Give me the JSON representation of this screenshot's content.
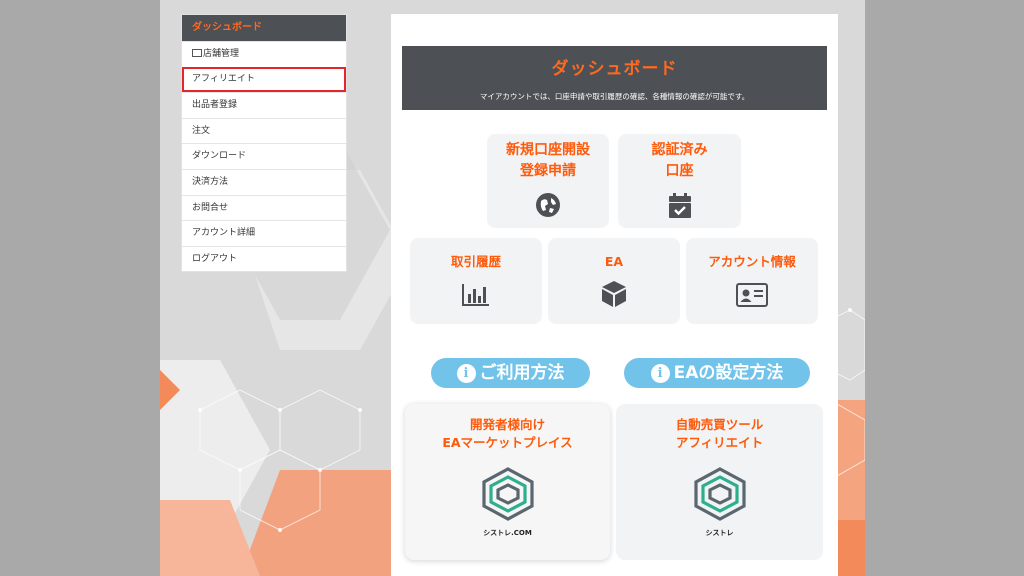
{
  "sidebar": {
    "header": "ダッシュボード",
    "items": [
      {
        "label": "店舗管理"
      },
      {
        "label": "アフィリエイト"
      },
      {
        "label": "出品者登録"
      },
      {
        "label": "注文"
      },
      {
        "label": "ダウンロード"
      },
      {
        "label": "決済方法"
      },
      {
        "label": "お問合せ"
      },
      {
        "label": "アカウント詳細"
      },
      {
        "label": "ログアウト"
      }
    ]
  },
  "hero": {
    "title": "ダッシュボード",
    "subtitle": "マイアカウントでは、口座申請や取引履歴の確認、各種情報の確認が可能です。"
  },
  "cards": {
    "new_account_line1": "新規口座開設",
    "new_account_line2": "登録申請",
    "verified_line1": "認証済み",
    "verified_line2": "口座",
    "history": "取引履歴",
    "ea": "EA",
    "account_info": "アカウント情報"
  },
  "guides": {
    "usage": "ご利用方法",
    "ea_setup": "EAの設定方法",
    "info_glyph": "i"
  },
  "promos": {
    "marketplace_line1": "開発者様向け",
    "marketplace_line2": "EAマーケットプレイス",
    "marketplace_logo_text": "シストレ.COM",
    "affiliate_line1": "自動売買ツール",
    "affiliate_line2": "アフィリエイト",
    "affiliate_logo_text": "シストレ"
  },
  "colors": {
    "accent": "#ff5a0a",
    "dark": "#4d5055",
    "pill": "#72c3ea",
    "active_border": "#e8242b"
  }
}
